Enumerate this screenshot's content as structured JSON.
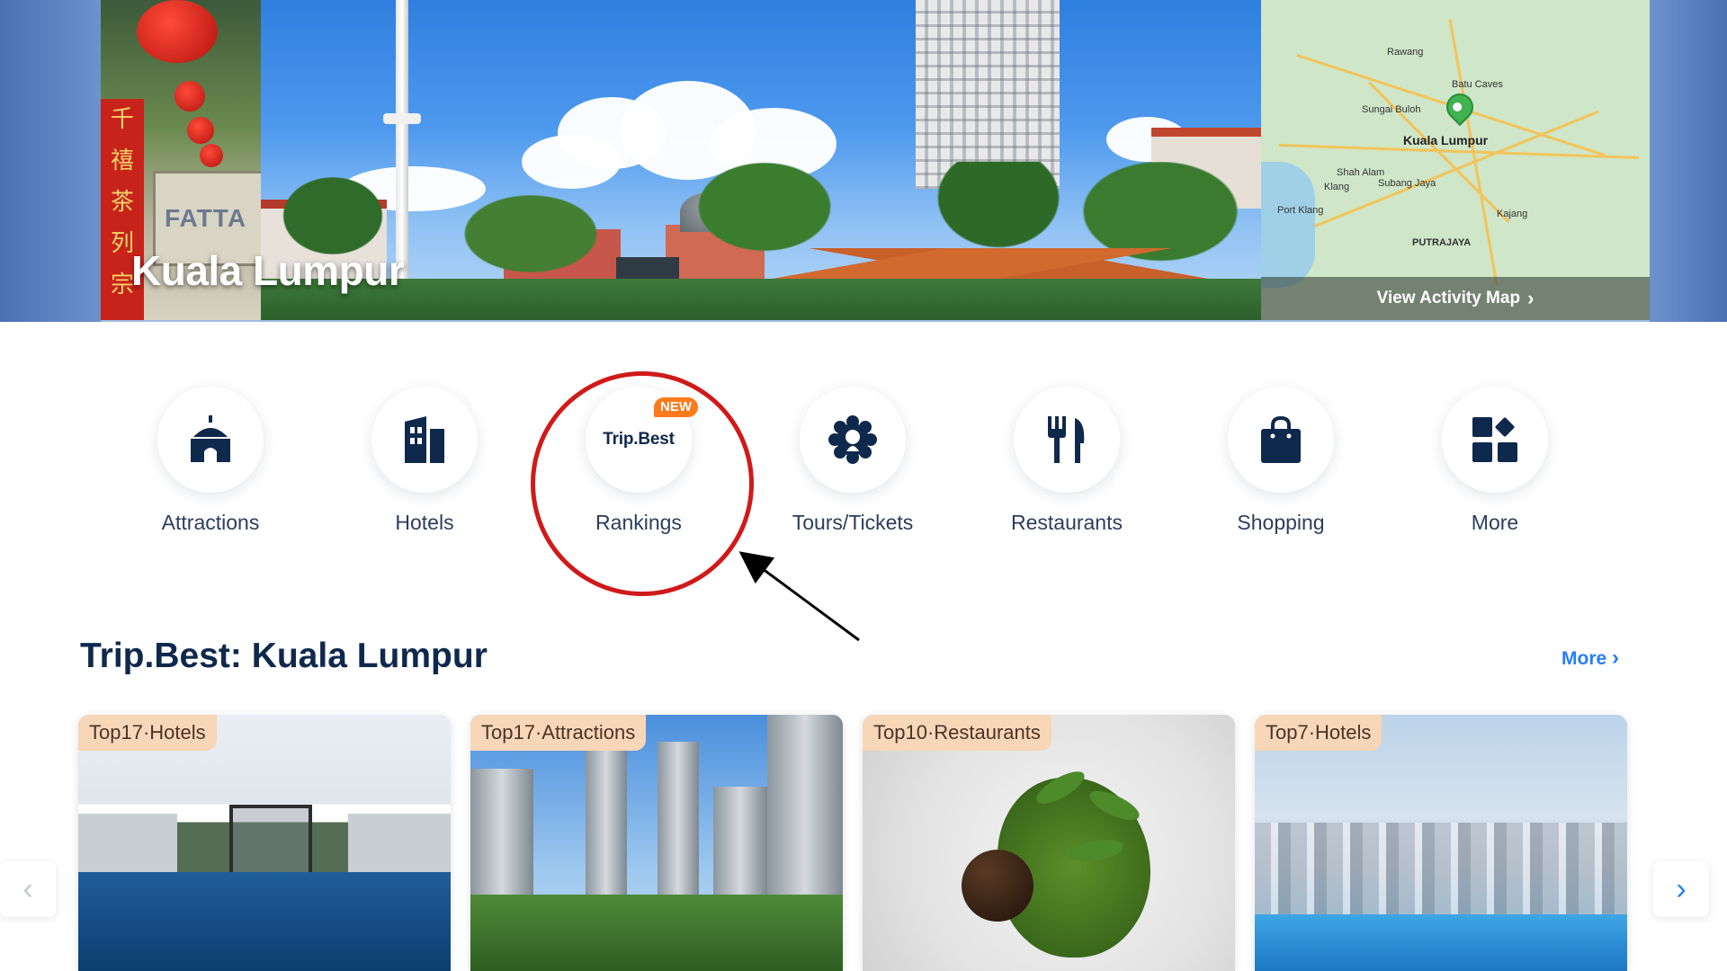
{
  "hero": {
    "city_title": "Kuala Lumpur",
    "small_photo_sign": "FATTA",
    "banner_glyphs": [
      "千",
      "禧",
      "茶",
      "列",
      "宗"
    ],
    "map": {
      "cta_label": "View Activity Map",
      "city_label": "Kuala Lumpur",
      "place_labels": [
        "Rawang",
        "Batu Caves",
        "Klang",
        "Shah Alam",
        "Subang Jaya",
        "Port Klang",
        "PUTRAJAYA",
        "Kajang",
        "Sungai Buloh"
      ]
    }
  },
  "categories": [
    {
      "label": "Attractions",
      "icon": "attractions-icon"
    },
    {
      "label": "Hotels",
      "icon": "hotel-icon"
    },
    {
      "label": "Rankings",
      "icon": "trip-best-logo",
      "logo_text": "Trip.Best",
      "badge": "NEW"
    },
    {
      "label": "Tours/Tickets",
      "icon": "tours-tickets-icon"
    },
    {
      "label": "Restaurants",
      "icon": "restaurant-icon"
    },
    {
      "label": "Shopping",
      "icon": "shopping-bag-icon"
    },
    {
      "label": "More",
      "icon": "more-grid-icon"
    }
  ],
  "section": {
    "title": "Trip.Best: Kuala Lumpur",
    "more_label": "More",
    "cards": [
      {
        "tag": "Top17·Hotels"
      },
      {
        "tag": "Top17·Attractions"
      },
      {
        "tag": "Top10·Restaurants"
      },
      {
        "tag": "Top7·Hotels"
      }
    ]
  },
  "colors": {
    "brand_navy": "#0f294d",
    "link_blue": "#287dfa",
    "new_badge": "#ff7a1a",
    "tag_bg": "#f8d6b8",
    "annotation_red": "#d01a1a"
  }
}
